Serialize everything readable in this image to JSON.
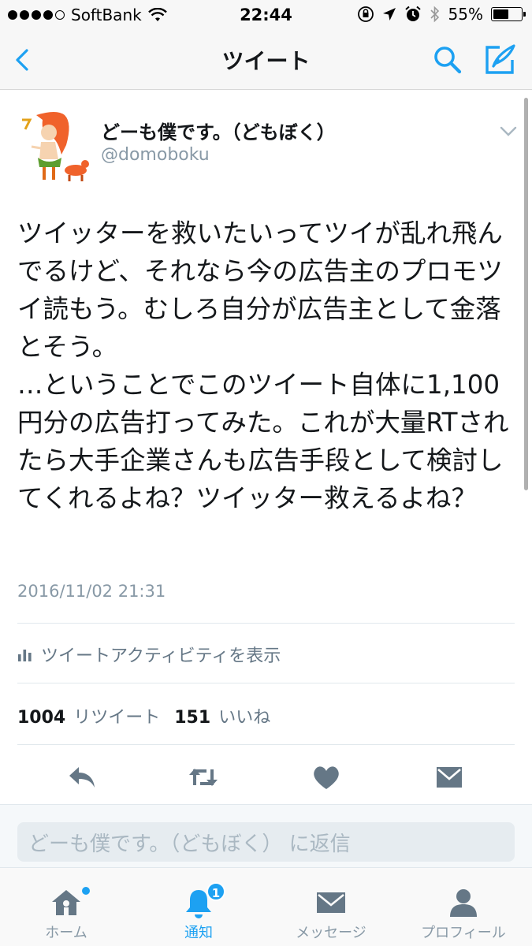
{
  "status_bar": {
    "carrier": "SoftBank",
    "time": "22:44",
    "battery_percent": "55%",
    "battery_level": 0.55
  },
  "nav": {
    "title": "ツイート"
  },
  "tweet": {
    "user_name": "どーも僕です。（どもぼく）",
    "handle": "@domoboku",
    "text": "ツイッターを救いたいってツイが乱れ飛んでるけど、それなら今の広告主のプロモツイ読もう。むしろ自分が広告主として金落とそう。\n…ということでこのツイート自体に1,100円分の広告打ってみた。これが大量RTされたら大手企業さんも広告手段として検討してくれるよね？ツイッター救えるよね？",
    "timestamp": "2016/11/02 21:31",
    "activity_label": "ツイートアクティビティを表示",
    "retweet_count": "1004",
    "retweet_label": "リツイート",
    "like_count": "151",
    "like_label": "いいね"
  },
  "reply": {
    "placeholder": "どーも僕です。（どもぼく） に返信"
  },
  "tabs": [
    {
      "label": "ホーム",
      "icon": "home-icon"
    },
    {
      "label": "通知",
      "icon": "bell-icon",
      "badge": "1"
    },
    {
      "label": "メッセージ",
      "icon": "envelope-icon"
    },
    {
      "label": "プロフィール",
      "icon": "person-icon"
    }
  ],
  "colors": {
    "accent": "#1da1f2",
    "icon_gray": "#657786",
    "secondary_text": "#8899a6"
  }
}
